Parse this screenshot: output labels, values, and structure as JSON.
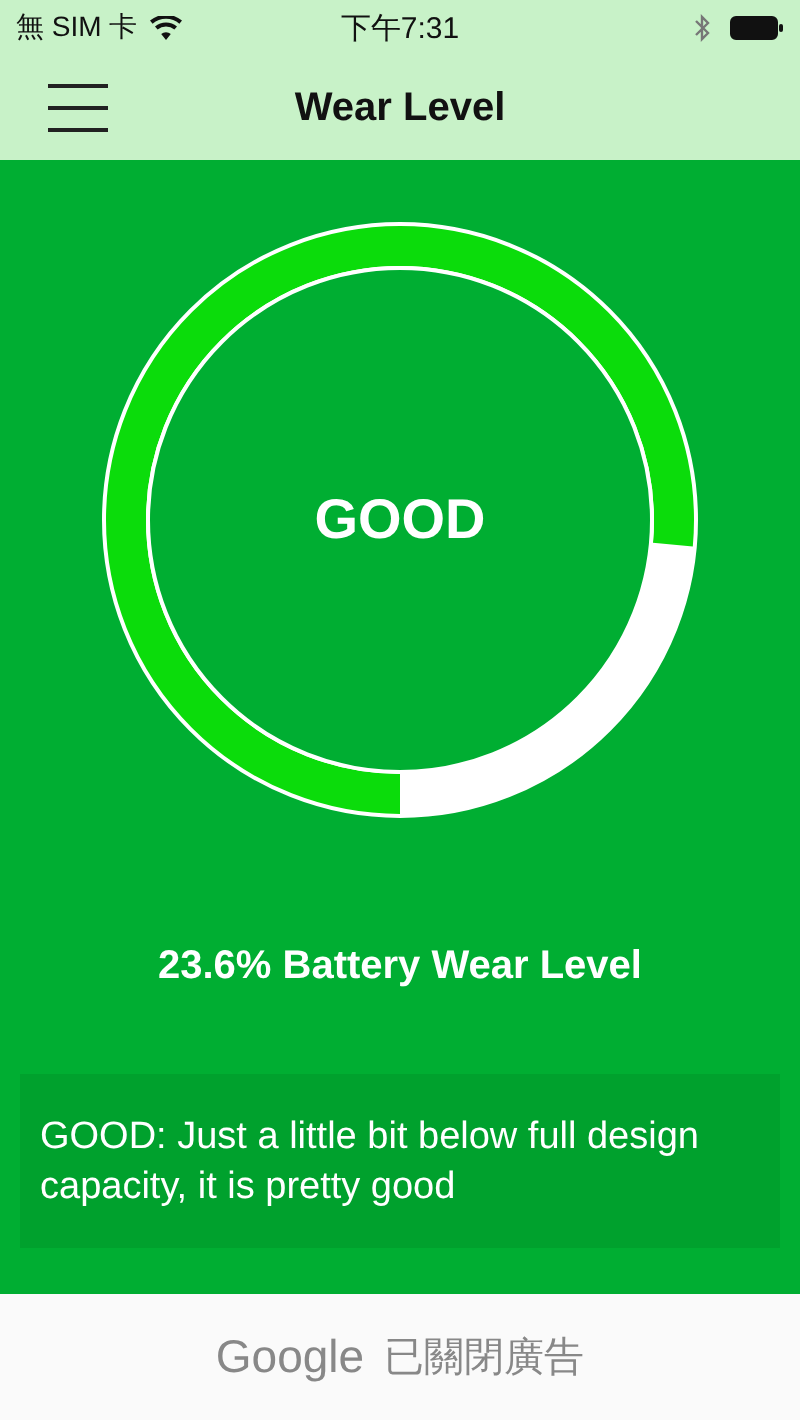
{
  "status_bar": {
    "carrier": "無 SIM 卡",
    "time": "下午7:31"
  },
  "nav_bar": {
    "title": "Wear Level"
  },
  "gauge": {
    "status": "GOOD",
    "level": 0.764
  },
  "wear_label": "23.6% Battery Wear Level",
  "message": "GOOD: Just a little bit below full design capacity, it is pretty good",
  "ad_bar": {
    "brand": "Google",
    "text": "已關閉廣告"
  }
}
